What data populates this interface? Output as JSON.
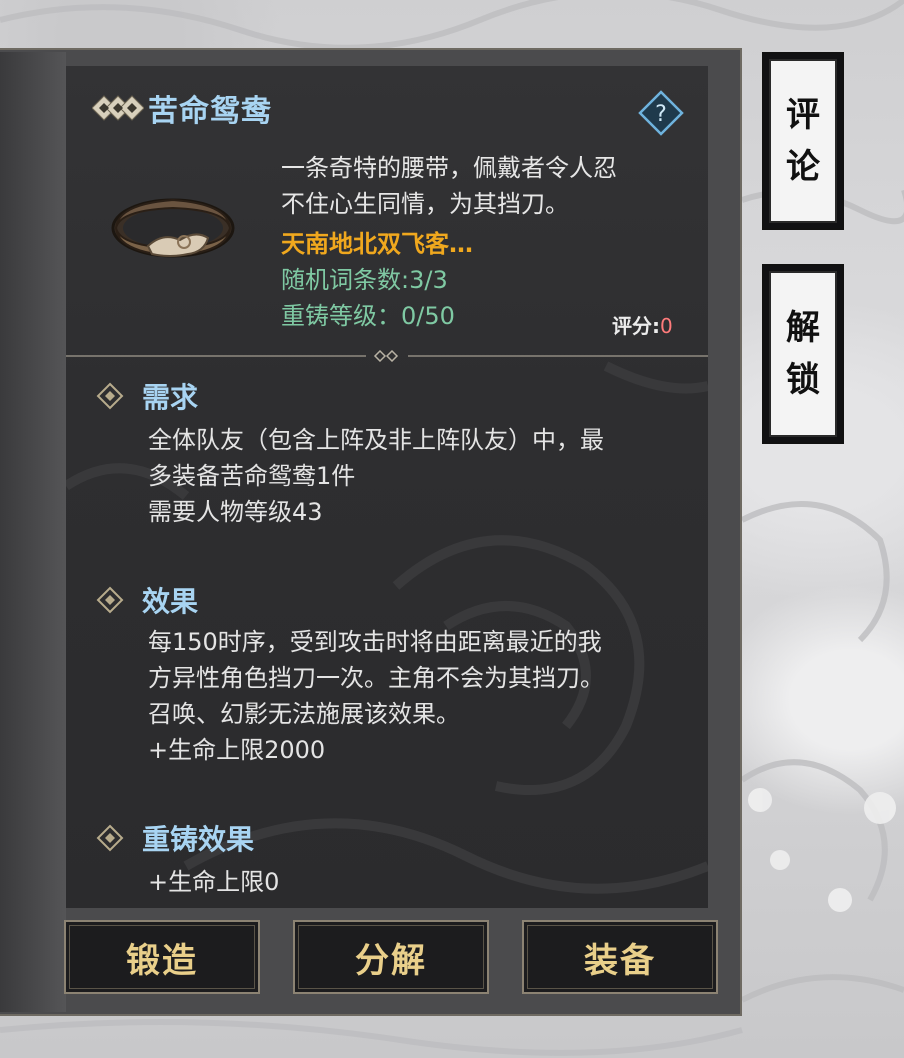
{
  "item": {
    "name": "苦命鸳鸯",
    "description_lines": [
      "一条奇特的腰带，佩戴者令人忍",
      "不住心生同情，为其挡刀。"
    ],
    "set_name": "天南地北双飞客…",
    "affix_count": "随机词条数:3/3",
    "reforge_level": "重铸等级：0/50",
    "score_label": "评分:",
    "score_value": "0",
    "help_icon": "?"
  },
  "sections": {
    "requirement": {
      "title": "需求",
      "lines": [
        "全体队友（包含上阵及非上阵队友）中，最",
        "多装备苦命鸳鸯1件",
        "需要人物等级43"
      ]
    },
    "effect": {
      "title": "效果",
      "lines": [
        "每150时序，受到攻击时将由距离最近的我",
        "方异性角色挡刀一次。主角不会为其挡刀。",
        "召唤、幻影无法施展该效果。",
        "+生命上限2000"
      ]
    },
    "reforge_effect": {
      "title": "重铸效果",
      "lines": [
        "+生命上限0"
      ]
    }
  },
  "buttons": {
    "forge": "锻造",
    "decompose": "分解",
    "equip": "装备"
  },
  "side_buttons": {
    "comment": [
      "评",
      "论"
    ],
    "unlock": [
      "解",
      "锁"
    ]
  },
  "colors": {
    "title_blue": "#a8d4f2",
    "set_orange": "#f0a81e",
    "stat_green": "#7fc9a3",
    "score_red": "#ff7b7b",
    "button_gold": "#e9cf8a"
  }
}
